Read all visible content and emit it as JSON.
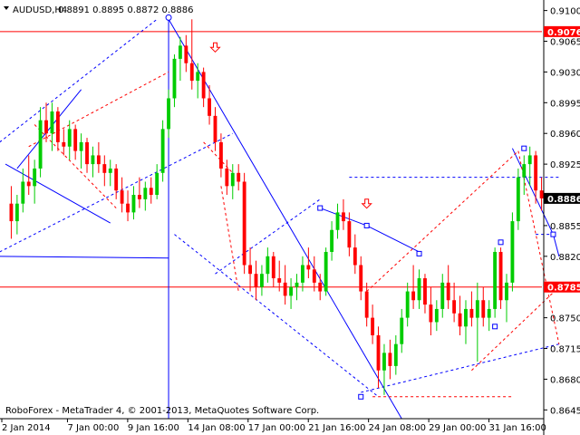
{
  "header": {
    "symbol": "AUDUSD,H4",
    "ohlc": "0.8891 0.8895 0.8872 0.8886"
  },
  "footer": {
    "copyright": "RoboForex - MetaTrader 4, © 2001-2013, MetaQuotes Software Corp."
  },
  "colors": {
    "background": "#ffffff",
    "bull_candle": "#00cc00",
    "bear_candle": "#ff0000",
    "trend_lines": "#0000ff",
    "forecast_lines": "#ff0000",
    "level_line": "#ff0000",
    "price_marker": "#000000"
  },
  "icons": [
    "down-arrow-icon",
    "down-arrow-icon",
    "dropdown-triangle-icon"
  ],
  "chart_data": {
    "type": "candlestick",
    "price_axis": [
      "0.9100",
      "0.9065",
      "0.9030",
      "0.8995",
      "0.8960",
      "0.8925",
      "0.8855",
      "0.8820",
      "0.8750",
      "0.8715",
      "0.8680",
      "0.8645"
    ],
    "price_markers": [
      {
        "label": "0.9076",
        "value": 0.9076,
        "kind": "level"
      },
      {
        "label": "0.8886",
        "value": 0.8886,
        "kind": "current"
      },
      {
        "label": "0.8785",
        "value": 0.8785,
        "kind": "level"
      }
    ],
    "time_axis": [
      "2 Jan 2014",
      "7 Jan 00:00",
      "9 Jan 16:00",
      "14 Jan 08:00",
      "17 Jan 00:00",
      "21 Jan 16:00",
      "24 Jan 08:00",
      "29 Jan 00:00",
      "31 Jan 16:00"
    ],
    "ylim": [
      0.8635,
      0.9112
    ],
    "levels": [
      0.9076,
      0.8785
    ],
    "candles": [
      [
        0.888,
        0.89,
        0.884,
        0.886
      ],
      [
        0.886,
        0.889,
        0.8845,
        0.888
      ],
      [
        0.888,
        0.892,
        0.887,
        0.8905
      ],
      [
        0.8905,
        0.8935,
        0.889,
        0.89
      ],
      [
        0.89,
        0.893,
        0.888,
        0.892
      ],
      [
        0.892,
        0.899,
        0.891,
        0.8975
      ],
      [
        0.8975,
        0.8995,
        0.895,
        0.896
      ],
      [
        0.896,
        0.8995,
        0.894,
        0.8985
      ],
      [
        0.8985,
        0.899,
        0.894,
        0.895
      ],
      [
        0.895,
        0.8965,
        0.8935,
        0.8945
      ],
      [
        0.8945,
        0.8975,
        0.893,
        0.8965
      ],
      [
        0.8965,
        0.897,
        0.893,
        0.894
      ],
      [
        0.894,
        0.896,
        0.892,
        0.895
      ],
      [
        0.895,
        0.8955,
        0.8915,
        0.8925
      ],
      [
        0.8925,
        0.8945,
        0.891,
        0.8935
      ],
      [
        0.8935,
        0.895,
        0.8915,
        0.8925
      ],
      [
        0.8925,
        0.8935,
        0.89,
        0.8915
      ],
      [
        0.8915,
        0.893,
        0.89,
        0.892
      ],
      [
        0.892,
        0.8925,
        0.8885,
        0.8895
      ],
      [
        0.8895,
        0.891,
        0.887,
        0.888
      ],
      [
        0.888,
        0.8895,
        0.886,
        0.887
      ],
      [
        0.887,
        0.89,
        0.8862,
        0.889
      ],
      [
        0.889,
        0.891,
        0.8875,
        0.8885
      ],
      [
        0.8885,
        0.8905,
        0.8872,
        0.8898
      ],
      [
        0.8898,
        0.891,
        0.888,
        0.889
      ],
      [
        0.889,
        0.8925,
        0.8885,
        0.8915
      ],
      [
        0.8915,
        0.8975,
        0.8905,
        0.8965
      ],
      [
        0.8965,
        0.901,
        0.8955,
        0.9
      ],
      [
        0.9,
        0.905,
        0.899,
        0.9045
      ],
      [
        0.9045,
        0.907,
        0.902,
        0.906
      ],
      [
        0.906,
        0.9072,
        0.903,
        0.904
      ],
      [
        0.904,
        0.909,
        0.901,
        0.902
      ],
      [
        0.902,
        0.904,
        0.9,
        0.903
      ],
      [
        0.903,
        0.9035,
        0.899,
        0.9
      ],
      [
        0.9,
        0.9015,
        0.897,
        0.898
      ],
      [
        0.898,
        0.899,
        0.894,
        0.895
      ],
      [
        0.895,
        0.896,
        0.891,
        0.892
      ],
      [
        0.892,
        0.893,
        0.889,
        0.89
      ],
      [
        0.89,
        0.8925,
        0.8885,
        0.8915
      ],
      [
        0.8915,
        0.8925,
        0.8895,
        0.8905
      ],
      [
        0.8905,
        0.8915,
        0.88,
        0.881
      ],
      [
        0.881,
        0.883,
        0.878,
        0.88
      ],
      [
        0.88,
        0.8815,
        0.877,
        0.8785
      ],
      [
        0.8785,
        0.881,
        0.8775,
        0.88
      ],
      [
        0.88,
        0.883,
        0.879,
        0.882
      ],
      [
        0.882,
        0.8825,
        0.8785,
        0.8795
      ],
      [
        0.8795,
        0.8815,
        0.878,
        0.879
      ],
      [
        0.879,
        0.881,
        0.8765,
        0.8775
      ],
      [
        0.8775,
        0.8795,
        0.876,
        0.8785
      ],
      [
        0.8785,
        0.88,
        0.877,
        0.879
      ],
      [
        0.879,
        0.882,
        0.878,
        0.881
      ],
      [
        0.881,
        0.883,
        0.8795,
        0.8805
      ],
      [
        0.8805,
        0.882,
        0.878,
        0.879
      ],
      [
        0.879,
        0.88,
        0.877,
        0.878
      ],
      [
        0.878,
        0.883,
        0.8775,
        0.8825
      ],
      [
        0.8825,
        0.886,
        0.8815,
        0.885
      ],
      [
        0.885,
        0.888,
        0.884,
        0.887
      ],
      [
        0.887,
        0.8885,
        0.885,
        0.886
      ],
      [
        0.886,
        0.887,
        0.882,
        0.883
      ],
      [
        0.883,
        0.8845,
        0.88,
        0.881
      ],
      [
        0.881,
        0.882,
        0.877,
        0.878
      ],
      [
        0.878,
        0.879,
        0.874,
        0.875
      ],
      [
        0.875,
        0.8765,
        0.872,
        0.873
      ],
      [
        0.873,
        0.874,
        0.867,
        0.869
      ],
      [
        0.869,
        0.872,
        0.8662,
        0.871
      ],
      [
        0.871,
        0.8725,
        0.868,
        0.8695
      ],
      [
        0.8695,
        0.873,
        0.8685,
        0.872
      ],
      [
        0.872,
        0.876,
        0.871,
        0.875
      ],
      [
        0.875,
        0.879,
        0.874,
        0.878
      ],
      [
        0.878,
        0.881,
        0.876,
        0.877
      ],
      [
        0.877,
        0.8805,
        0.876,
        0.8795
      ],
      [
        0.8795,
        0.88,
        0.8755,
        0.8765
      ],
      [
        0.8765,
        0.8785,
        0.873,
        0.8745
      ],
      [
        0.8745,
        0.877,
        0.8735,
        0.876
      ],
      [
        0.876,
        0.88,
        0.875,
        0.879
      ],
      [
        0.879,
        0.881,
        0.876,
        0.877
      ],
      [
        0.877,
        0.879,
        0.8745,
        0.8755
      ],
      [
        0.8755,
        0.8775,
        0.873,
        0.874
      ],
      [
        0.874,
        0.877,
        0.872,
        0.876
      ],
      [
        0.876,
        0.878,
        0.874,
        0.875
      ],
      [
        0.875,
        0.879,
        0.87,
        0.877
      ],
      [
        0.877,
        0.8785,
        0.874,
        0.875
      ],
      [
        0.875,
        0.877,
        0.8735,
        0.876
      ],
      [
        0.876,
        0.883,
        0.875,
        0.8825
      ],
      [
        0.8825,
        0.883,
        0.876,
        0.877
      ],
      [
        0.877,
        0.88,
        0.8745,
        0.879
      ],
      [
        0.879,
        0.887,
        0.878,
        0.886
      ],
      [
        0.886,
        0.892,
        0.885,
        0.891
      ],
      [
        0.891,
        0.8935,
        0.889,
        0.8925
      ],
      [
        0.8925,
        0.8945,
        0.89,
        0.8935
      ],
      [
        0.8935,
        0.894,
        0.888,
        0.8895
      ],
      [
        0.8895,
        0.891,
        0.8872,
        0.8886
      ]
    ],
    "trend_lines": [
      {
        "t0": -1,
        "p0": 0.895,
        "t1": 26,
        "p1": 0.909,
        "style": "dashed",
        "color": "#0000ff"
      },
      {
        "t0": -1,
        "p0": 0.8825,
        "t1": 39,
        "p1": 0.896,
        "style": "dashed",
        "color": "#0000ff"
      },
      {
        "t0": 0,
        "p0": 0.8925,
        "t1": 18,
        "p1": 0.8858,
        "style": "solid",
        "color": "#0000ff"
      },
      {
        "t0": 2,
        "p0": 0.892,
        "t1": 13,
        "p1": 0.901,
        "style": "solid",
        "color": "#0000ff"
      },
      {
        "t0": -1,
        "p0": 0.882,
        "t1": 28,
        "p1": 0.8818,
        "style": "solid",
        "color": "#0000ff"
      },
      {
        "t0": 28,
        "p0": 0.909,
        "t1": 68,
        "p1": 0.8635,
        "style": "solid",
        "color": "#0000ff"
      },
      {
        "t0": 54,
        "p0": 0.8875,
        "t1": 62,
        "p1": 0.8855,
        "style": "solid",
        "color": "#0000ff"
      },
      {
        "t0": 62,
        "p0": 0.8855,
        "t1": 71,
        "p1": 0.8825,
        "style": "solid",
        "color": "#0000ff"
      },
      {
        "t0": 59,
        "p0": 0.891,
        "t1": 95,
        "p1": 0.891,
        "style": "dashed",
        "color": "#0000ff"
      },
      {
        "t0": 29,
        "p0": 0.8845,
        "t1": 64,
        "p1": 0.866,
        "style": "dashed",
        "color": "#0000ff"
      },
      {
        "t0": 36,
        "p0": 0.88,
        "t1": 54,
        "p1": 0.8885,
        "style": "dashed",
        "color": "#0000ff"
      },
      {
        "t0": 61,
        "p0": 0.8665,
        "t1": 95,
        "p1": 0.872,
        "style": "dashed",
        "color": "#0000ff"
      },
      {
        "t0": 87,
        "p0": 0.8943,
        "t1": 94,
        "p1": 0.8845,
        "style": "solid",
        "color": "#0000ff"
      },
      {
        "t0": 91,
        "p0": 0.8845,
        "t1": 94,
        "p1": 0.8845,
        "style": "dashed",
        "color": "#0000ff"
      },
      {
        "t0": 94,
        "p0": 0.8845,
        "t1": 95,
        "p1": 0.882,
        "style": "solid",
        "color": "#0000ff"
      },
      {
        "t0": 5,
        "p0": 0.897,
        "t1": 19,
        "p1": 0.8875,
        "style": "dashed",
        "color": "#ff0000"
      },
      {
        "t0": 4,
        "p0": 0.8945,
        "t1": 28,
        "p1": 0.903,
        "style": "dashed",
        "color": "#ff0000"
      },
      {
        "t0": 34,
        "p0": 0.895,
        "t1": 39,
        "p1": 0.8915,
        "style": "dashed",
        "color": "#ff0000"
      },
      {
        "t0": 37,
        "p0": 0.89,
        "t1": 40,
        "p1": 0.878,
        "style": "dashed",
        "color": "#ff0000"
      },
      {
        "t0": 62,
        "p0": 0.878,
        "t1": 88,
        "p1": 0.894,
        "style": "dashed",
        "color": "#ff0000"
      },
      {
        "t0": 63,
        "p0": 0.866,
        "t1": 87,
        "p1": 0.866,
        "style": "dashed",
        "color": "#ff0000"
      },
      {
        "t0": 80,
        "p0": 0.869,
        "t1": 95,
        "p1": 0.8785,
        "style": "dashed",
        "color": "#ff0000"
      },
      {
        "t0": 88,
        "p0": 0.894,
        "t1": 95,
        "p1": 0.872,
        "style": "dashed",
        "color": "#ff0000"
      }
    ],
    "vertical_lines": [
      {
        "t": 28
      }
    ],
    "markers": [
      {
        "t": 28,
        "p": 0.9092,
        "kind": "circle"
      },
      {
        "t": 54,
        "p": 0.8875,
        "kind": "square"
      },
      {
        "t": 62,
        "p": 0.8855,
        "kind": "square"
      },
      {
        "t": 71,
        "p": 0.8823,
        "kind": "square"
      },
      {
        "t": 61,
        "p": 0.866,
        "kind": "square"
      },
      {
        "t": 84,
        "p": 0.874,
        "kind": "square"
      },
      {
        "t": 85,
        "p": 0.8836,
        "kind": "square"
      },
      {
        "t": 89,
        "p": 0.8943,
        "kind": "square"
      },
      {
        "t": 94,
        "p": 0.8845,
        "kind": "square"
      }
    ],
    "arrows": [
      {
        "t": 36,
        "p": 0.9058
      },
      {
        "t": 62,
        "p": 0.888
      }
    ]
  }
}
